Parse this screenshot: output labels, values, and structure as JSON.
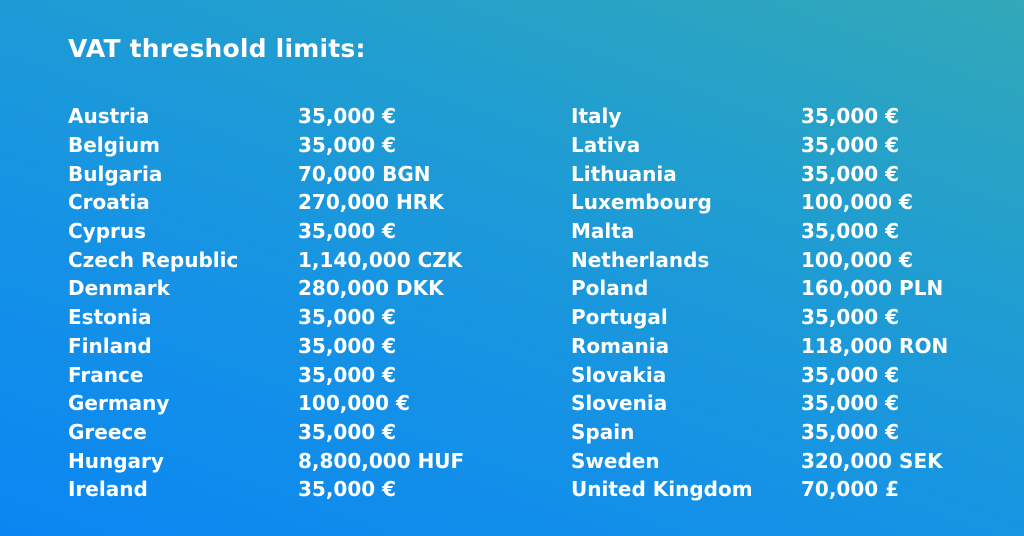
{
  "title": "VAT threshold limits:",
  "left_column": [
    {
      "country": "Austria",
      "value": "35,000 €"
    },
    {
      "country": "Belgium",
      "value": "35,000 €"
    },
    {
      "country": "Bulgaria",
      "value": "70,000 BGN"
    },
    {
      "country": "Croatia",
      "value": "270,000 HRK"
    },
    {
      "country": "Cyprus",
      "value": "35,000 €"
    },
    {
      "country": "Czech Republic",
      "value": "1,140,000 CZK"
    },
    {
      "country": "Denmark",
      "value": "280,000 DKK"
    },
    {
      "country": "Estonia",
      "value": "35,000 €"
    },
    {
      "country": "Finland",
      "value": "35,000 €"
    },
    {
      "country": "France",
      "value": "35,000 €"
    },
    {
      "country": "Germany",
      "value": "100,000 €"
    },
    {
      "country": "Greece",
      "value": "35,000 €"
    },
    {
      "country": "Hungary",
      "value": "8,800,000 HUF"
    },
    {
      "country": "Ireland",
      "value": "35,000 €"
    }
  ],
  "right_column": [
    {
      "country": "Italy",
      "value": "35,000 €"
    },
    {
      "country": "Lativa",
      "value": "35,000 €"
    },
    {
      "country": "Lithuania",
      "value": "35,000 €"
    },
    {
      "country": "Luxembourg",
      "value": "100,000 €"
    },
    {
      "country": "Malta",
      "value": "35,000 €"
    },
    {
      "country": "Netherlands",
      "value": "100,000 €"
    },
    {
      "country": "Poland",
      "value": "160,000 PLN"
    },
    {
      "country": "Portugal",
      "value": "35,000 €"
    },
    {
      "country": "Romania",
      "value": "118,000 RON"
    },
    {
      "country": "Slovakia",
      "value": "35,000 €"
    },
    {
      "country": "Slovenia",
      "value": "35,000 €"
    },
    {
      "country": "Spain",
      "value": "35,000 €"
    },
    {
      "country": "Sweden",
      "value": "320,000 SEK"
    },
    {
      "country": "United Kingdom",
      "value": "70,000 £"
    }
  ],
  "colors": {
    "background_start": "#0a86f2",
    "background_end": "#32a8b8",
    "text": "#ffffff"
  }
}
